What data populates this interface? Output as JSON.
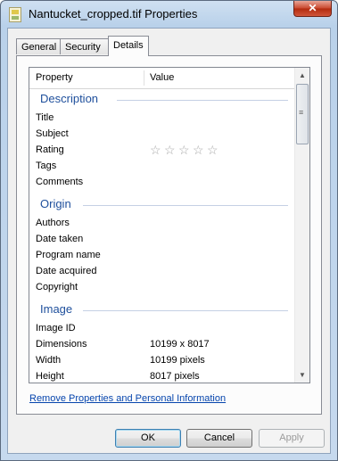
{
  "window": {
    "title": "Nantucket_cropped.tif Properties",
    "close_label": "✕"
  },
  "tabs": [
    {
      "label": "General"
    },
    {
      "label": "Security"
    },
    {
      "label": "Details",
      "active": true
    }
  ],
  "list": {
    "columns": {
      "property": "Property",
      "value": "Value"
    },
    "groups": {
      "description": {
        "label": "Description",
        "rows": [
          {
            "property": "Title",
            "value": ""
          },
          {
            "property": "Subject",
            "value": ""
          },
          {
            "property": "Rating",
            "value": ""
          },
          {
            "property": "Tags",
            "value": ""
          },
          {
            "property": "Comments",
            "value": ""
          }
        ]
      },
      "origin": {
        "label": "Origin",
        "rows": [
          {
            "property": "Authors",
            "value": ""
          },
          {
            "property": "Date taken",
            "value": ""
          },
          {
            "property": "Program name",
            "value": ""
          },
          {
            "property": "Date acquired",
            "value": ""
          },
          {
            "property": "Copyright",
            "value": ""
          }
        ]
      },
      "image": {
        "label": "Image",
        "rows": [
          {
            "property": "Image ID",
            "value": ""
          },
          {
            "property": "Dimensions",
            "value": "10199 x 8017"
          },
          {
            "property": "Width",
            "value": "10199 pixels"
          },
          {
            "property": "Height",
            "value": "8017 pixels"
          }
        ]
      }
    },
    "rating": {
      "stars": 5,
      "filled": 0,
      "glyph": "☆"
    }
  },
  "scrollbar": {
    "up_arrow": "▲",
    "down_arrow": "▼",
    "grip": "≡"
  },
  "links": {
    "remove_properties": "Remove Properties and Personal Information"
  },
  "buttons": {
    "ok": "OK",
    "cancel": "Cancel",
    "apply": "Apply"
  }
}
